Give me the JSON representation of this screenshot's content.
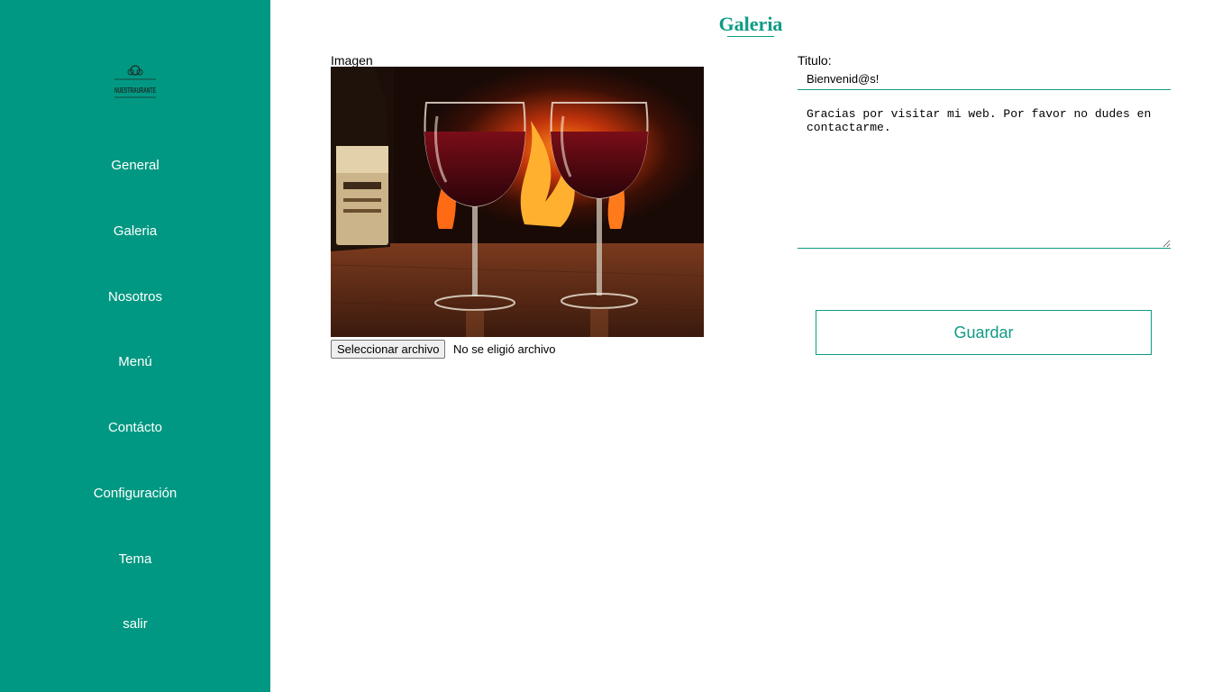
{
  "brand": {
    "logo_icon": "restaurant-logo-icon",
    "logo_text": "NUESTRAURANTE",
    "primary_color": "#009882",
    "accent_color": "#0f9b85"
  },
  "sidebar": {
    "items": [
      {
        "label": "General"
      },
      {
        "label": "Galeria"
      },
      {
        "label": "Nosotros"
      },
      {
        "label": "Menú"
      },
      {
        "label": "Contácto"
      },
      {
        "label": "Configuración"
      },
      {
        "label": "Tema"
      },
      {
        "label": "salir"
      }
    ]
  },
  "main": {
    "title": "Galeria",
    "image_section": {
      "label": "Imagen",
      "file_button_label": "Seleccionar archivo",
      "file_status": "No se eligió archivo"
    },
    "form": {
      "title_label": "Titulo:",
      "title_value": "Bienvenid@s!",
      "body_value": "Gracias por visitar mi web. Por favor no dudes en contactarme.",
      "save_label": "Guardar"
    }
  }
}
